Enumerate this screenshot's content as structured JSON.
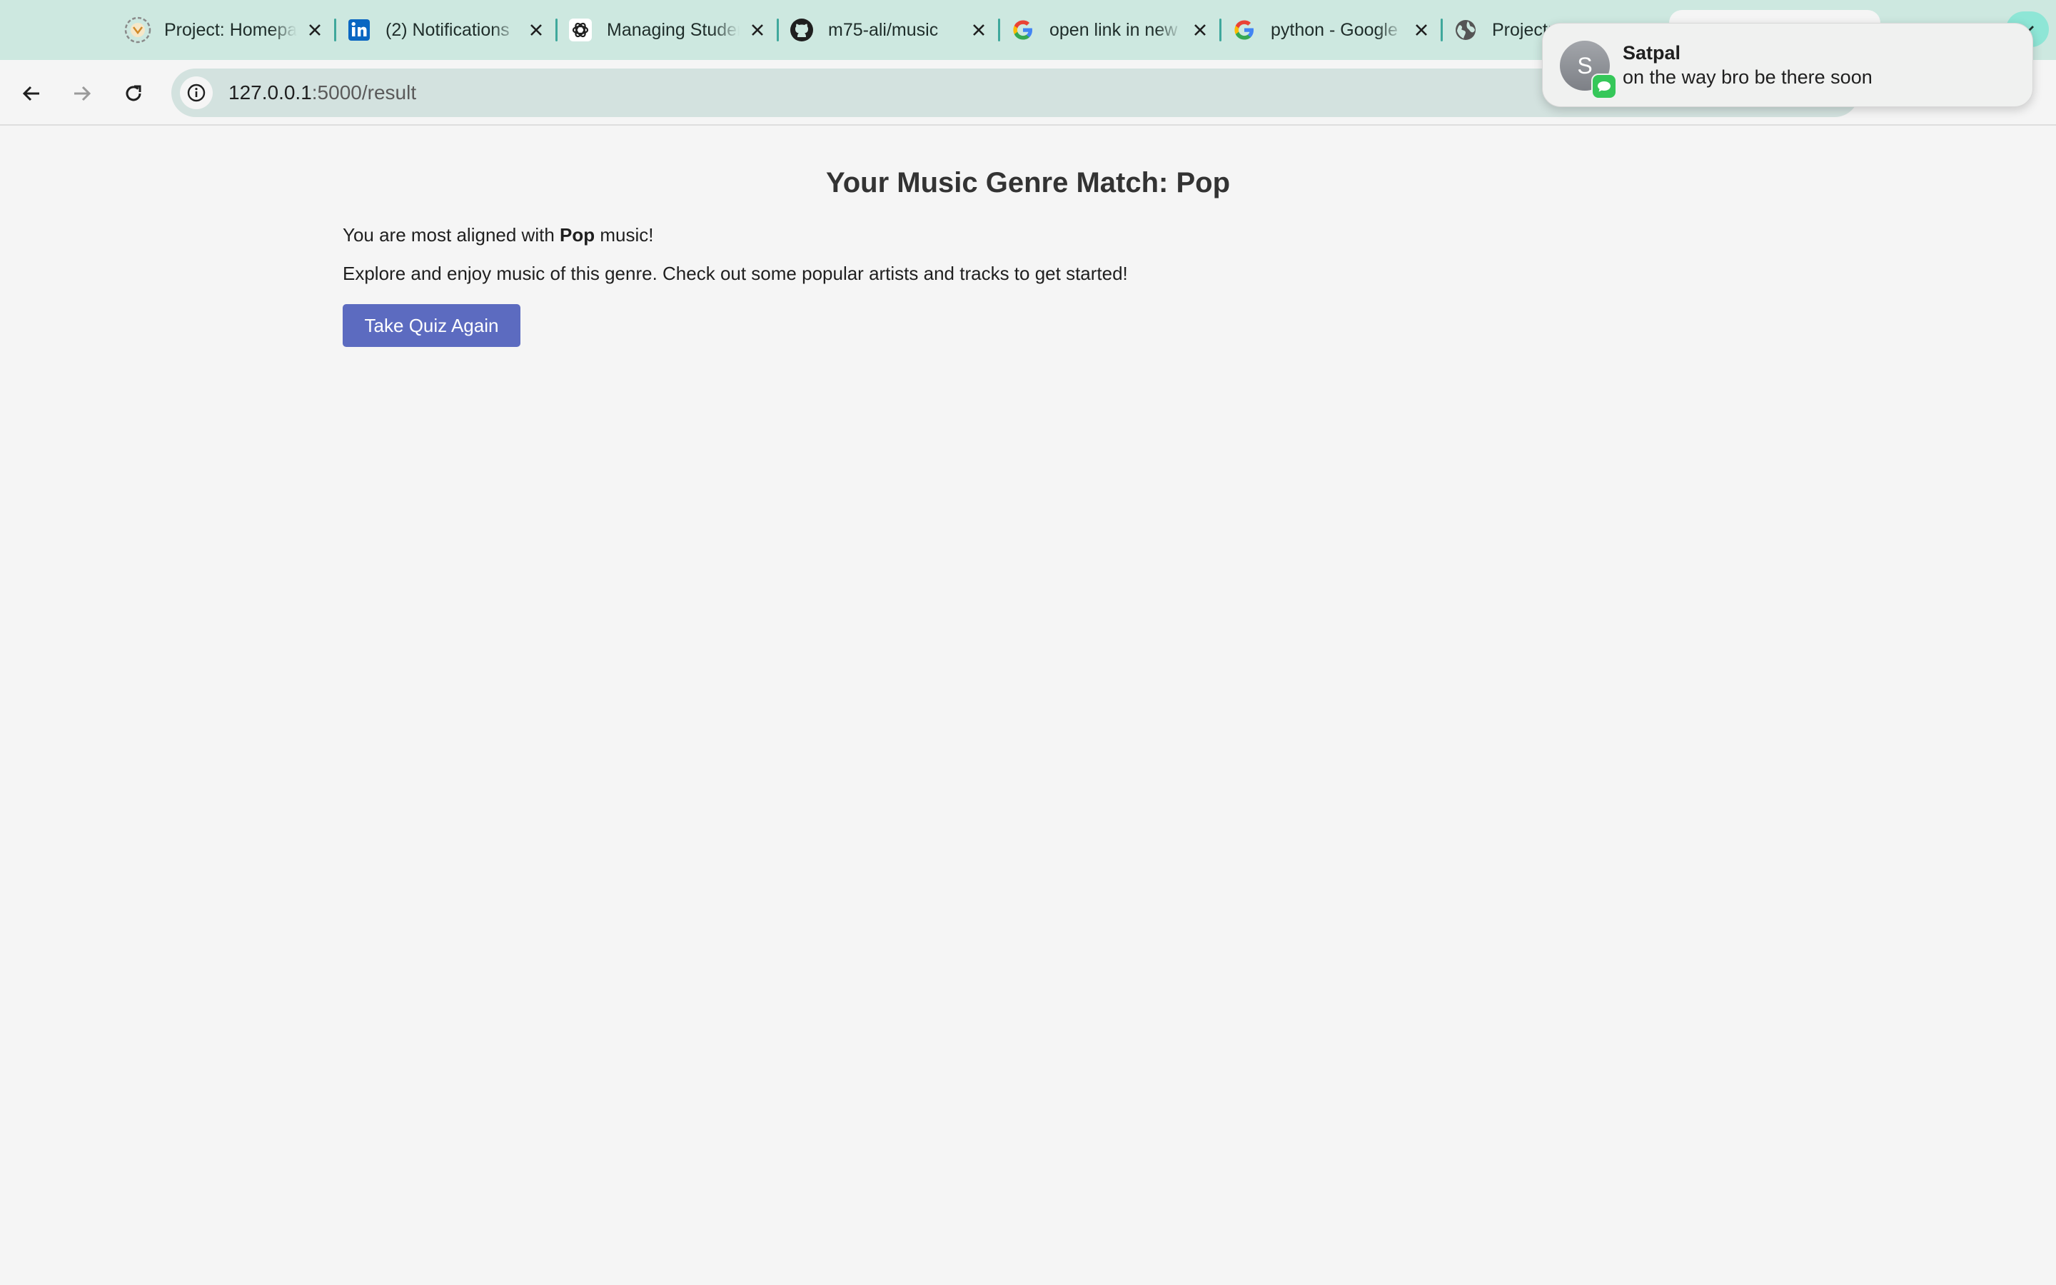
{
  "browser": {
    "tabs": [
      {
        "title": "Project: Homepage",
        "icon": "project-favicon"
      },
      {
        "title": "(2) Notifications",
        "icon": "linkedin-icon"
      },
      {
        "title": "Managing Student",
        "icon": "openai-icon"
      },
      {
        "title": "m75-ali/music",
        "icon": "github-icon"
      },
      {
        "title": "open link in new",
        "icon": "google-icon"
      },
      {
        "title": "python - Google",
        "icon": "google-icon"
      },
      {
        "title": "Project: M",
        "icon": "globe-icon"
      }
    ],
    "url_host": "127.0.0.1",
    "url_path": ":5000/result"
  },
  "notification": {
    "avatar_initial": "S",
    "sender": "Satpal",
    "message": "on the way bro be there soon",
    "app_icon": "messages-icon"
  },
  "page": {
    "heading": "Your Music Genre Match: Pop",
    "aligned_prefix": "You are most aligned with ",
    "genre": "Pop",
    "aligned_suffix": " music!",
    "explore_text": "Explore and enjoy music of this genre. Check out some popular artists and tracks to get started!",
    "button_label": "Take Quiz Again"
  },
  "colors": {
    "tabstrip": "#cde8e0",
    "accent_button": "#5c6bc0",
    "page_background": "#f5f5f5"
  }
}
